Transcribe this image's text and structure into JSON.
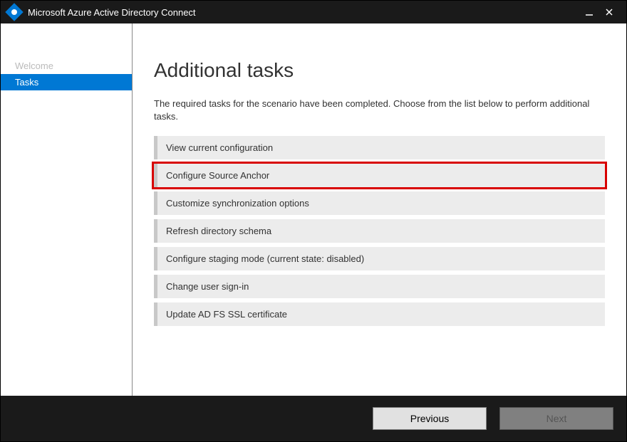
{
  "titlebar": {
    "title": "Microsoft Azure Active Directory Connect"
  },
  "sidebar": {
    "items": [
      {
        "label": "Welcome",
        "active": false
      },
      {
        "label": "Tasks",
        "active": true
      }
    ]
  },
  "main": {
    "heading": "Additional tasks",
    "description": "The required tasks for the scenario have been completed. Choose from the list below to perform additional tasks.",
    "tasks": [
      {
        "label": "View current configuration",
        "highlight": false
      },
      {
        "label": "Configure Source Anchor",
        "highlight": true
      },
      {
        "label": "Customize synchronization options",
        "highlight": false
      },
      {
        "label": "Refresh directory schema",
        "highlight": false
      },
      {
        "label": "Configure staging mode (current state: disabled)",
        "highlight": false
      },
      {
        "label": "Change user sign-in",
        "highlight": false
      },
      {
        "label": "Update AD FS SSL certificate",
        "highlight": false
      }
    ]
  },
  "footer": {
    "previous": "Previous",
    "next": "Next"
  }
}
